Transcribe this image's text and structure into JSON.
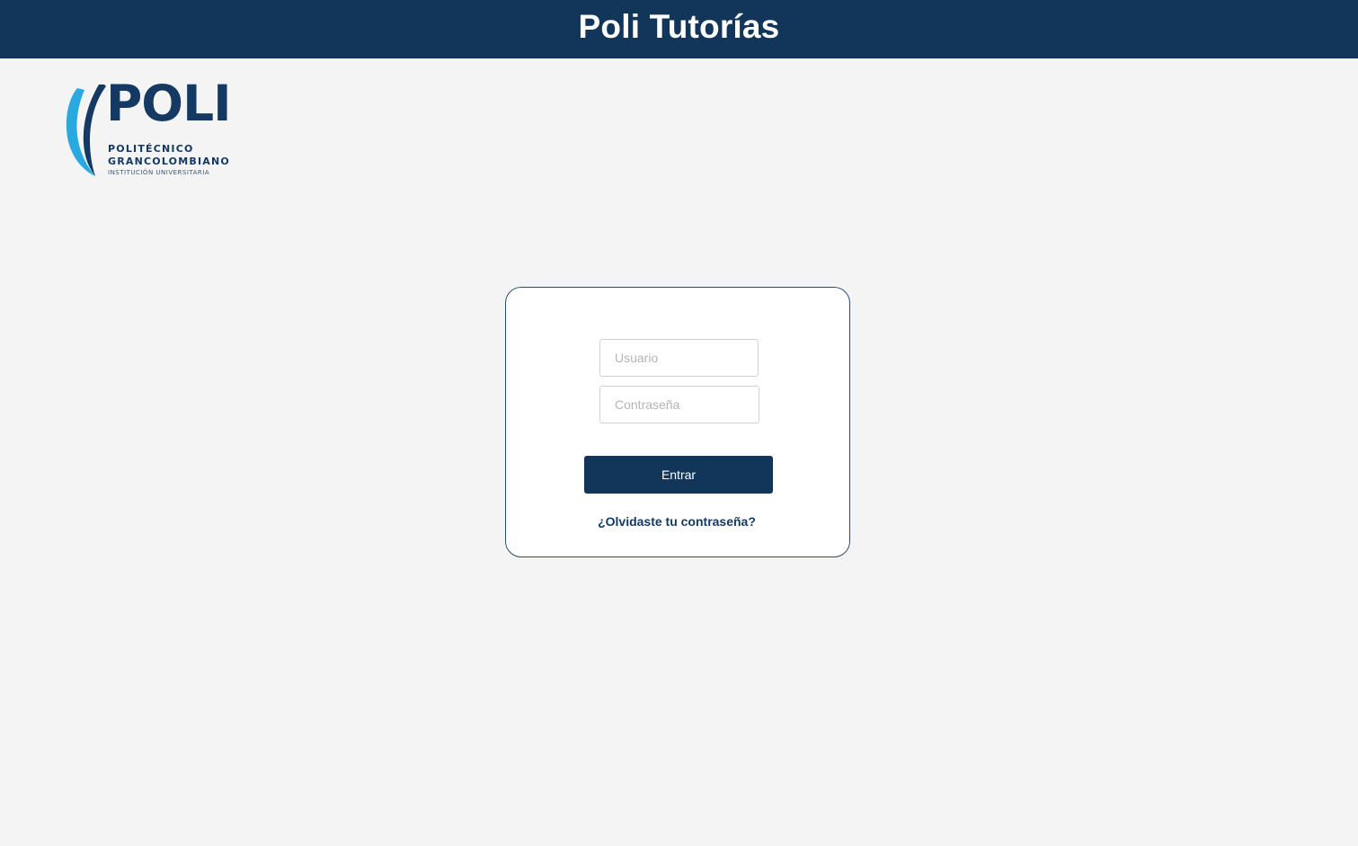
{
  "header": {
    "title": "Poli Tutorías"
  },
  "logo": {
    "wordmark": "POLI",
    "line1": "POLITÉCNICO",
    "line2": "GRANCOLOMBIANO",
    "line3": "INSTITUCIÓN UNIVERSITARIA",
    "icon": "poli-logo-icon"
  },
  "login": {
    "username_placeholder": "Usuario",
    "username_value": "",
    "password_placeholder": "Contraseña",
    "password_value": "",
    "submit_label": "Entrar",
    "forgot_label": "¿Olvidaste tu contraseña?"
  },
  "colors": {
    "brand_navy": "#12365a",
    "logo_accent_blue": "#29a9df",
    "background": "#f4f4f4"
  }
}
